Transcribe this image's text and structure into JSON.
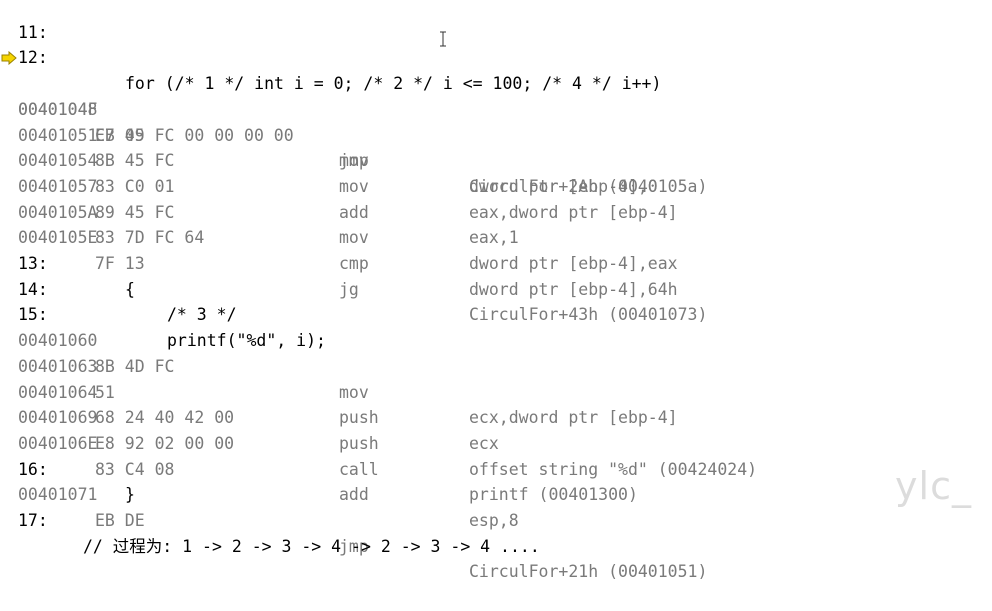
{
  "source_lines": [
    {
      "number": "11:",
      "code": ""
    },
    {
      "number": "12:",
      "code": "for (/* 1 */ int i = 0; /* 2 */ i <= 100; /* 4 */ i++)"
    },
    {
      "number": "13:",
      "code": "{"
    },
    {
      "number": "14:",
      "code": "/* 3 */"
    },
    {
      "number": "15:",
      "code": "printf(\"%d\", i);"
    },
    {
      "number": "16:",
      "code": "}"
    },
    {
      "number": "17:",
      "code": "// 过程为: 1 -> 2 -> 3 -> 4 -> 2 -> 3 -> 4 ...."
    }
  ],
  "asm_lines": [
    {
      "addr": "00401048",
      "bytes": "C7 45 FC 00 00 00 00",
      "mnemonic": "mov",
      "operands": "dword ptr [ebp-4],0"
    },
    {
      "addr": "0040104F",
      "bytes": "EB 09",
      "mnemonic": "jmp",
      "operands": "CirculFor+2Ah (0040105a)"
    },
    {
      "addr": "00401051",
      "bytes": "8B 45 FC",
      "mnemonic": "mov",
      "operands": "eax,dword ptr [ebp-4]"
    },
    {
      "addr": "00401054",
      "bytes": "83 C0 01",
      "mnemonic": "add",
      "operands": "eax,1"
    },
    {
      "addr": "00401057",
      "bytes": "89 45 FC",
      "mnemonic": "mov",
      "operands": "dword ptr [ebp-4],eax"
    },
    {
      "addr": "0040105A",
      "bytes": "83 7D FC 64",
      "mnemonic": "cmp",
      "operands": "dword ptr [ebp-4],64h"
    },
    {
      "addr": "0040105E",
      "bytes": "7F 13",
      "mnemonic": "jg",
      "operands": "CirculFor+43h (00401073)"
    },
    {
      "addr": "00401060",
      "bytes": "8B 4D FC",
      "mnemonic": "mov",
      "operands": "ecx,dword ptr [ebp-4]"
    },
    {
      "addr": "00401063",
      "bytes": "51",
      "mnemonic": "push",
      "operands": "ecx"
    },
    {
      "addr": "00401064",
      "bytes": "68 24 40 42 00",
      "mnemonic": "push",
      "operands": "offset string \"%d\" (00424024)"
    },
    {
      "addr": "00401069",
      "bytes": "E8 92 02 00 00",
      "mnemonic": "call",
      "operands": "printf (00401300)"
    },
    {
      "addr": "0040106E",
      "bytes": "83 C4 08",
      "mnemonic": "add",
      "operands": "esp,8"
    },
    {
      "addr": "00401071",
      "bytes": "EB DE",
      "mnemonic": "jmp",
      "operands": "CirculFor+21h (00401051)"
    }
  ],
  "current_instruction_marker": "arrow-icon",
  "watermark": "ylc_",
  "colors": {
    "source_text": "#000000",
    "asm_text": "#7a7a7a",
    "arrow_fill": "#f5d400",
    "arrow_stroke": "#9a8200",
    "background": "#ffffff"
  }
}
